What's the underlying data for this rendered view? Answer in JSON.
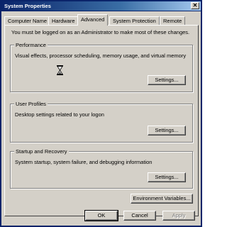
{
  "window": {
    "title": "System Properties",
    "close_glyph": "✕"
  },
  "tabs": [
    {
      "label": "Computer Name"
    },
    {
      "label": "Hardware"
    },
    {
      "label": "Advanced"
    },
    {
      "label": "System Protection"
    },
    {
      "label": "Remote"
    }
  ],
  "active_tab": "Advanced",
  "notice": "You must be logged on as an Administrator to make most of these changes.",
  "groups": {
    "performance": {
      "title": "Performance",
      "description": "Visual effects, processor scheduling, memory usage, and virtual memory",
      "button": "Settings..."
    },
    "user_profiles": {
      "title": "User Profiles",
      "description": "Desktop settings related to your logon",
      "button": "Settings..."
    },
    "startup_recovery": {
      "title": "Startup and Recovery",
      "description": "System startup, system failure, and debugging information",
      "button": "Settings..."
    }
  },
  "env_button": "Environment Variables...",
  "footer": {
    "ok": "OK",
    "cancel": "Cancel",
    "apply": "Apply"
  },
  "icons": {
    "busy_cursor": "hourglass-icon"
  },
  "colors": {
    "titlebar_start": "#0a246a",
    "titlebar_end": "#a6caf0",
    "face": "#d4d0c8"
  }
}
